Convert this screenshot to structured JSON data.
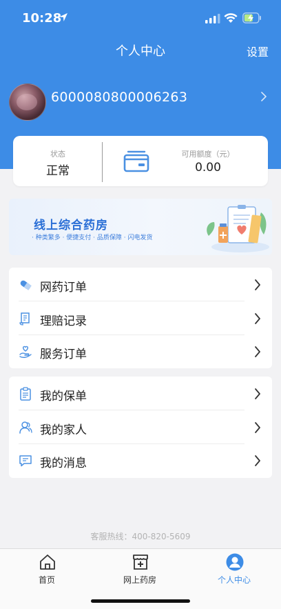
{
  "status_bar": {
    "time": "10:28"
  },
  "nav": {
    "title": "个人中心",
    "settings_label": "设置"
  },
  "profile": {
    "user_id": "6000080800006263"
  },
  "summary": {
    "status_label": "状态",
    "status_value": "正常",
    "credit_label": "可用额度（元）",
    "credit_value": "0.00"
  },
  "banner": {
    "title": "线上综合药房",
    "subtitle": "· 种类繁多 · 便捷支付 · 品质保障 · 闪电发货"
  },
  "menu_group1": [
    {
      "label": "网药订单",
      "icon": "pill-icon"
    },
    {
      "label": "理赔记录",
      "icon": "document-icon"
    },
    {
      "label": "服务订单",
      "icon": "service-hand-icon"
    }
  ],
  "menu_group2": [
    {
      "label": "我的保单",
      "icon": "clipboard-icon"
    },
    {
      "label": "我的家人",
      "icon": "family-icon"
    },
    {
      "label": "我的消息",
      "icon": "message-icon"
    }
  ],
  "hotline": "客服热线：400-820-5609",
  "tabbar": {
    "items": [
      {
        "label": "首页",
        "icon": "home-icon"
      },
      {
        "label": "网上药房",
        "icon": "pharmacy-icon"
      },
      {
        "label": "个人中心",
        "icon": "profile-icon"
      }
    ],
    "active_color": "#3d8ce6"
  },
  "colors": {
    "brand": "#3d8ce6",
    "background": "#f2f2f4"
  }
}
